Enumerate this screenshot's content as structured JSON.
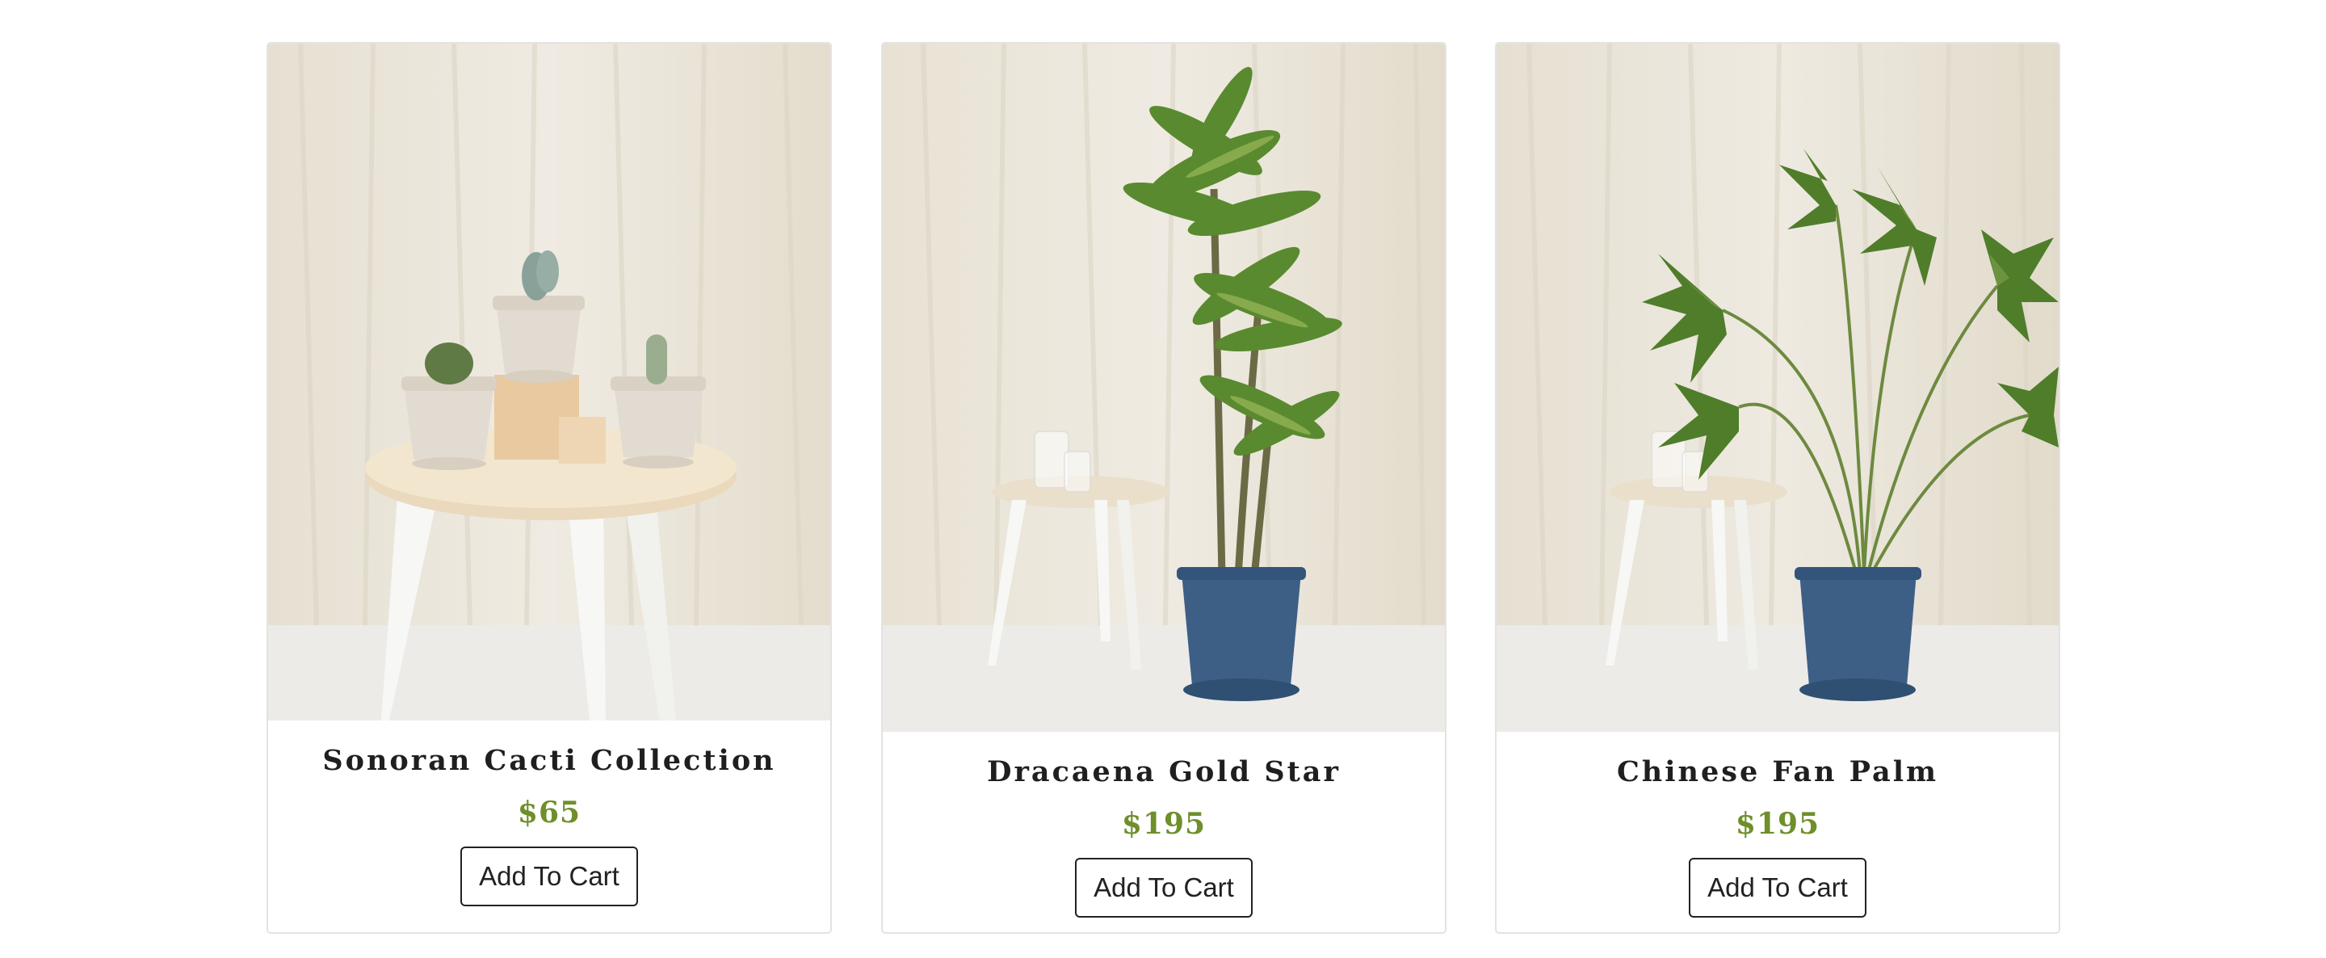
{
  "products": [
    {
      "name": "Sonoran Cacti Collection",
      "price": "$65",
      "button_label": "Add To Cart",
      "image_icon": "cacti-on-stool-photo"
    },
    {
      "name": "Dracaena Gold Star",
      "price": "$195",
      "button_label": "Add To Cart",
      "image_icon": "dracaena-plant-photo"
    },
    {
      "name": "Chinese Fan Palm",
      "price": "$195",
      "button_label": "Add To Cart",
      "image_icon": "fan-palm-photo"
    }
  ],
  "colors": {
    "price": "#6f8f2b",
    "backdrop": "#ebe6da",
    "floor": "#ecebe8",
    "pot_blue": "#3d5f86"
  }
}
